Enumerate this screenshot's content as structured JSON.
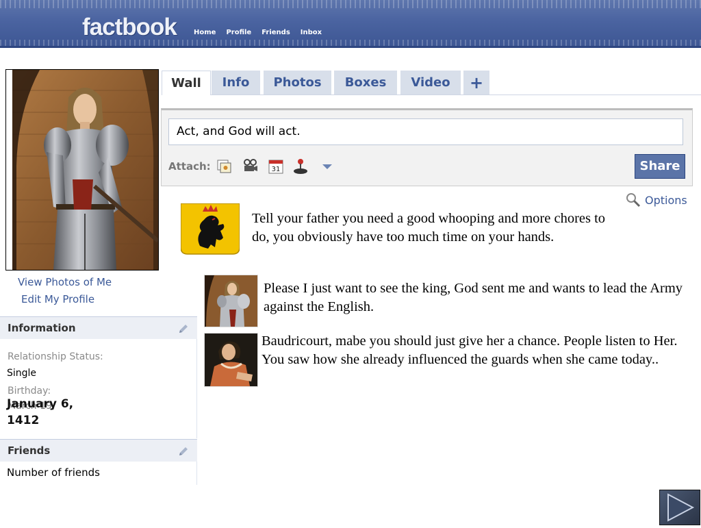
{
  "header": {
    "logo": "factbook",
    "nav": [
      "Home",
      "Profile",
      "Friends",
      "Inbox"
    ]
  },
  "sidebar": {
    "view_photos": "View Photos of Me",
    "edit_profile": "Edit My Profile",
    "information": {
      "title": "Information",
      "relationship_label": "Relationship Status:",
      "relationship_value": "Single",
      "birthday_label": "Birthday:",
      "birthday_ghost": "March 19,",
      "birthday_value": "January 6, 1412"
    },
    "friends": {
      "title": "Friends",
      "count_text": "Number of friends"
    }
  },
  "tabs": [
    "Wall",
    "Info",
    "Photos",
    "Boxes",
    "Video",
    "+"
  ],
  "composer": {
    "status_text": "Act, and God will act.",
    "attach_label": "Attach:",
    "attach_icons": [
      "photo-icon",
      "video-icon",
      "event-icon",
      "joystick-icon",
      "dropdown-arrow-icon"
    ],
    "calendar_number": "31",
    "share_label": "Share",
    "options_label": "Options"
  },
  "posts": [
    {
      "author_icon": "lion-crest-icon",
      "text": "Tell your father you need a good whooping and more chores to do, you obviously have too much time on your hands."
    },
    {
      "author_icon": "joan-avatar",
      "text": "Please I just want to see the king, God sent me and wants to lead the Army against the English."
    },
    {
      "author_icon": "woman-avatar",
      "text": "Baudricourt, mabe you should just give her a chance. People listen to Her. You saw how she already influenced the guards when she came today.."
    }
  ],
  "colors": {
    "brand_blue": "#3b5998",
    "header_blue": "#4a63a0",
    "tab_bg": "#d8dfea",
    "share_bg": "#5b74a8",
    "crest_yellow": "#f3c300"
  }
}
